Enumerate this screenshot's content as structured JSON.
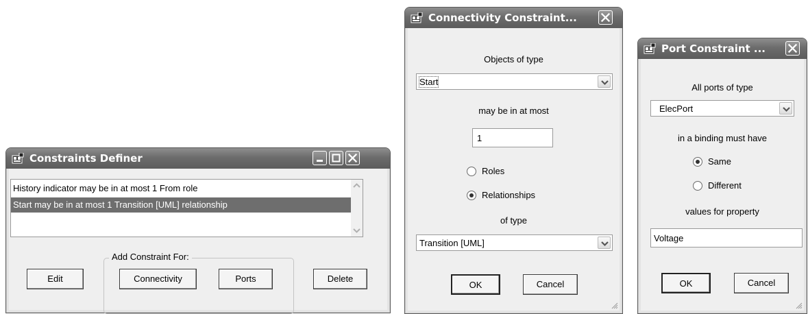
{
  "constraints_definer": {
    "title": "Constraints Definer",
    "items": [
      "History indicator may be in at most 1 From role",
      "Start may be in at most 1 Transition [UML] relationship"
    ],
    "selected_index": 1,
    "group_label": "Add Constraint For:",
    "buttons": {
      "edit": "Edit",
      "connectivity": "Connectivity",
      "ports": "Ports",
      "delete": "Delete"
    }
  },
  "connectivity_dialog": {
    "title": "Connectivity Constraint...",
    "objects_label": "Objects of type",
    "object_type": "Start",
    "may_be_label": "may be in at most",
    "count": "1",
    "roles_label": "Roles",
    "relationships_label": "Relationships",
    "selected_option": "Relationships",
    "of_type_label": "of type",
    "relationship_type": "Transition [UML]",
    "ok": "OK",
    "cancel": "Cancel"
  },
  "port_dialog": {
    "title": "Port Constraint ...",
    "all_ports_label": "All ports of type",
    "port_type": "ElecPort",
    "binding_label": "in a binding must have",
    "same_label": "Same",
    "different_label": "Different",
    "selected_option": "Same",
    "values_label": "values for property",
    "property": "Voltage",
    "ok": "OK",
    "cancel": "Cancel"
  },
  "colors": {
    "titlebar": "#6c6c6c",
    "selection": "#6e6e6e",
    "client": "#efefef"
  }
}
